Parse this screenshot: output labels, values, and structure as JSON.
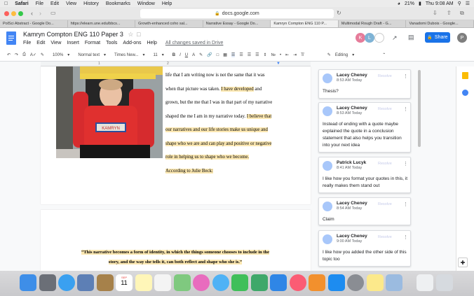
{
  "menubar": {
    "apple": "",
    "items": [
      "Safari",
      "File",
      "Edit",
      "View",
      "History",
      "Bookmarks",
      "Window",
      "Help"
    ],
    "battery": "21%",
    "clock": "Thu 9:08 AM"
  },
  "browser": {
    "url": "docs.google.com",
    "tabs": [
      "PolSci Abstract - Google Do...",
      "https://elearn.une.edu/bbcs...",
      "Growth-enhanced coho sal...",
      "Narrative Essay - Google Do...",
      "Kamryn Compton ENG 110 P...",
      "Multimodal Rough Draft - G...",
      "Vanadomi Dubois - Google..."
    ]
  },
  "doc": {
    "title": "Kamryn Compton ENG 110 Paper 3",
    "saved": "All changes saved in Drive",
    "menu": [
      "File",
      "Edit",
      "View",
      "Insert",
      "Format",
      "Tools",
      "Add-ons",
      "Help"
    ],
    "share": "Share",
    "user_initial": "P",
    "collab_initials": [
      "K",
      "L"
    ]
  },
  "format_bar": {
    "zoom": "100%",
    "style": "Normal text",
    "font": "Times New...",
    "size": "11",
    "mode": "Editing"
  },
  "ruler_marks": [
    "1",
    "2"
  ],
  "body": {
    "lines": [
      {
        "text": "life that I am writing now is not the same that it was",
        "hl": ""
      },
      {
        "text": "when that picture was taken. ",
        "hl": "I have developed",
        "tail": " and"
      },
      {
        "text": "grown, but the me that I was in that part of my narrative",
        "hl": ""
      },
      {
        "text": "shaped the me I am in my narrative today. ",
        "hl": "I believe that",
        "tail": ""
      },
      {
        "text": "",
        "hl": "our narratives and our life stories make us unique and",
        "tail": ""
      },
      {
        "text": "",
        "hl": "shape who we are and can play and positive or negative",
        "tail": ""
      },
      {
        "text": "",
        "hl": "role in helping us to shape who we become.",
        "tail": ""
      },
      {
        "text": "",
        "hl": "According to Julie Beck:",
        "tail": ""
      }
    ],
    "quote_line1": "“This narrative becomes a form of identity, in which the things someone chooses to include in the",
    "quote_line2": "story, and the way she tells it, can both reflect and shape who she is.”",
    "license_plate": "KAMRYN"
  },
  "comments": [
    {
      "author": "Lacey Cheney",
      "time": "8:53 AM Today",
      "resolve": "Resolve",
      "text": "Thesis?"
    },
    {
      "author": "Lacey Cheney",
      "time": "8:53 AM Today",
      "resolve": "Resolve",
      "text": "Instead of ending with a quote maybe explained the quote in a conclusion statement that also helps you transition into your next idea"
    },
    {
      "author": "Patrick Lucyk",
      "time": "8:41 AM Today",
      "resolve": "Resolve",
      "text": "I like how you format your quotes in this, it really makes them stand out"
    },
    {
      "author": "Lacey Cheney",
      "time": "8:54 AM Today",
      "resolve": "Resolve",
      "text": "Claim"
    },
    {
      "author": "Lacey Cheney",
      "time": "9:00 AM Today",
      "resolve": "Resolve",
      "text": "I like how you added the other side of this topic too"
    }
  ],
  "dock": {
    "calendar_day": "11",
    "calendar_month": "SEP"
  },
  "colors": {
    "accent": "#1a73e8",
    "highlight": "#fce8b2",
    "docs_blue": "#4285f4"
  }
}
